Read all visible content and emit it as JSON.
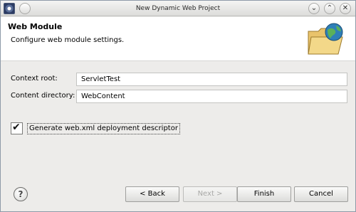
{
  "window": {
    "title": "New Dynamic Web Project",
    "controls": {
      "minimize": "⌄",
      "maximize": "⌃",
      "close": "✕"
    }
  },
  "header": {
    "title": "Web Module",
    "description": "Configure web module settings."
  },
  "form": {
    "context_root": {
      "label": "Context root:",
      "value": "ServletTest"
    },
    "content_directory": {
      "label": "Content directory:",
      "value": "WebContent"
    },
    "generate_descriptor": {
      "label": "Generate web.xml deployment descriptor",
      "checked": true
    }
  },
  "buttons": {
    "help": "?",
    "back": "< Back",
    "next": "Next >",
    "finish": "Finish",
    "cancel": "Cancel"
  }
}
